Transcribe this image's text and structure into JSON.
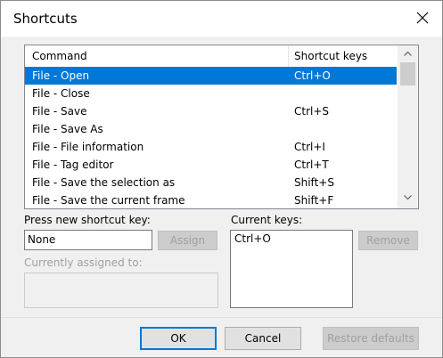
{
  "dialog": {
    "title": "Shortcuts"
  },
  "list": {
    "headers": {
      "command": "Command",
      "keys": "Shortcut keys"
    },
    "rows": [
      {
        "command": "File - Open",
        "keys": "Ctrl+O",
        "selected": true
      },
      {
        "command": "File - Close",
        "keys": ""
      },
      {
        "command": "File - Save",
        "keys": "Ctrl+S"
      },
      {
        "command": "File - Save As",
        "keys": ""
      },
      {
        "command": "File - File information",
        "keys": "Ctrl+I"
      },
      {
        "command": "File - Tag editor",
        "keys": "Ctrl+T"
      },
      {
        "command": "File - Save the selection as",
        "keys": "Shift+S"
      },
      {
        "command": "File - Save the current frame",
        "keys": "Shift+F"
      }
    ]
  },
  "new_shortcut": {
    "label": "Press new shortcut key:",
    "value": "None",
    "assign_label": "Assign"
  },
  "assigned": {
    "label": "Currently assigned to:",
    "value": ""
  },
  "current_keys": {
    "label": "Current keys:",
    "value": "Ctrl+O",
    "remove_label": "Remove"
  },
  "footer": {
    "ok_label": "OK",
    "cancel_label": "Cancel",
    "restore_label": "Restore defaults"
  },
  "colors": {
    "selection": "#0078d7",
    "window_bg": "#f0f0f0"
  }
}
